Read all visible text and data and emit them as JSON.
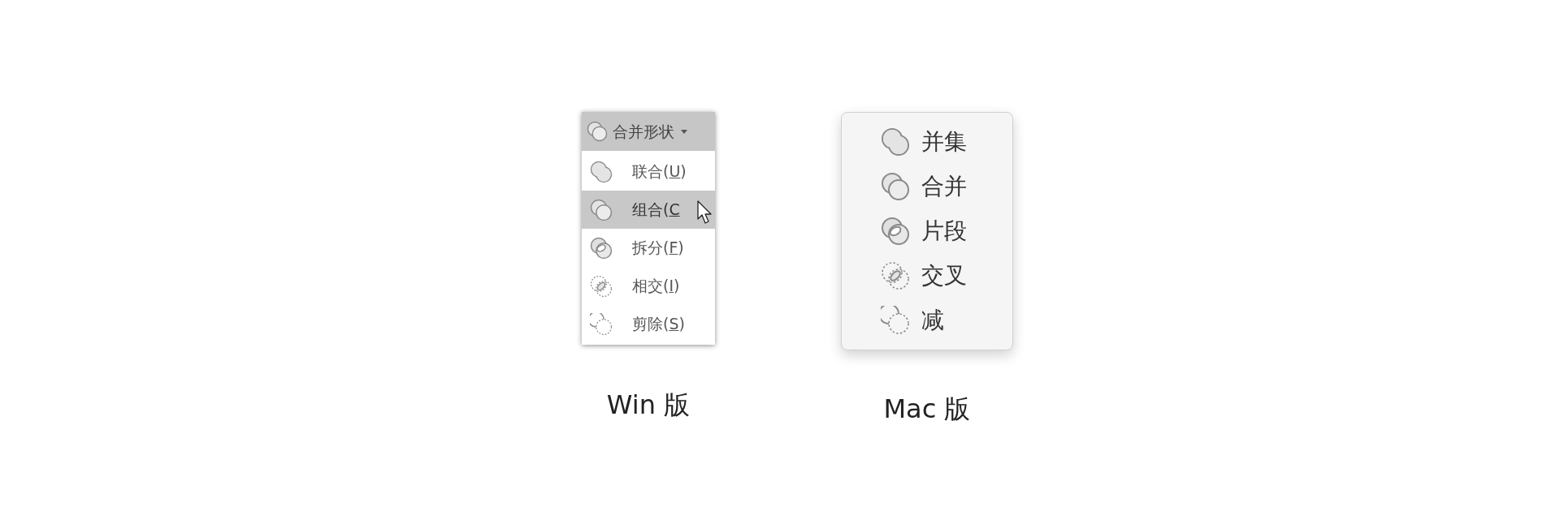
{
  "win_menu": {
    "button": {
      "label": "合并形状",
      "kind": "combine"
    },
    "items": [
      {
        "kind": "union",
        "before": "联合(",
        "mnemonic": "U",
        "after": ")",
        "selected": false
      },
      {
        "kind": "combine",
        "before": "组合(",
        "mnemonic": "C",
        "selected": true
      },
      {
        "kind": "fragment",
        "before": "拆分(",
        "mnemonic": "F",
        "after": ")",
        "selected": false
      },
      {
        "kind": "intersect",
        "before": "相交(",
        "mnemonic": "I",
        "after": ")",
        "selected": false
      },
      {
        "kind": "subtract",
        "before": "剪除(",
        "mnemonic": "S",
        "after": ")",
        "selected": false
      }
    ],
    "caption": "Win 版"
  },
  "mac_menu": {
    "items": [
      {
        "kind": "union",
        "label": "并集"
      },
      {
        "kind": "combine",
        "label": "合并"
      },
      {
        "kind": "fragment",
        "label": "片段"
      },
      {
        "kind": "intersect",
        "label": "交叉"
      },
      {
        "kind": "subtract",
        "label": "减"
      }
    ],
    "caption": "Mac 版"
  }
}
